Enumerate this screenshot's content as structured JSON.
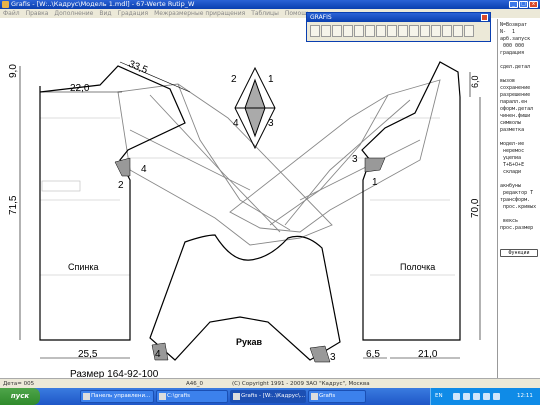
{
  "window": {
    "title": "Grafis - [W:..\\Кадрус\\Модель 1.mdl] - 67-Werte Rutip_W",
    "buttons": [
      "_",
      "□",
      "x"
    ]
  },
  "menu": [
    "Файл",
    "Правка",
    "Дополнение",
    "Вид",
    "Градация",
    "Межразмерные приращения",
    "Таблицы",
    "Помощь"
  ],
  "grafis_toolbar": {
    "title": "GRAFIS",
    "tool_count": 15
  },
  "side_panel": {
    "lines": [
      "N=Возврат",
      "N-  1",
      "арб.запуск",
      " 000 000",
      "градация",
      "",
      "сдел.детал",
      "",
      "вызов",
      "сохранение",
      "разрешение",
      "паралл.ен",
      "оформ.детал",
      "чинен.фиши",
      "символы",
      "разметка",
      "",
      "модел-ие",
      " неремос",
      " уцепиа",
      " Т+Б+О+Е",
      " склади",
      "",
      "акнбуны",
      " редактор Т",
      "трансформ.",
      " прос.кривых",
      "",
      " вексь",
      "прос.размер"
    ],
    "button": "Функции"
  },
  "pattern": {
    "back_dims": {
      "top_width": "22,0",
      "shoulder": "33,5",
      "neck_height": "9,0",
      "length": "71,5",
      "bottom_width": "25,5"
    },
    "front_dims": {
      "neck_height": "6,0",
      "length": "70,0",
      "bottom_left": "6,5",
      "bottom_right": "21,0"
    },
    "labels": {
      "back": "Спинка",
      "front": "Полочка",
      "sleeve": "Рукав",
      "size": "Размер 164-92-100"
    },
    "notches": {
      "back_4": "4",
      "back_2": "2",
      "front_3": "3",
      "front_1": "1",
      "sleeve_4": "4",
      "sleeve_3": "3"
    },
    "diamond": {
      "top_left": "2",
      "top_right": "1",
      "bottom_left": "4",
      "bottom_right": "3"
    }
  },
  "status": {
    "detail": "Дета= 005",
    "code": "A46_0",
    "copyright": "(C) Copyright 1991 - 2009 ЗАО \"Кадрус\", Москва"
  },
  "taskbar": {
    "start": "пуск",
    "tasks": [
      {
        "label": "Панель управлени...",
        "active": false
      },
      {
        "label": "C:\\grafis",
        "active": false
      },
      {
        "label": "Grafis - [W:..\\Кадрус\\...",
        "active": true
      },
      {
        "label": "Grafis",
        "active": false
      }
    ],
    "lang": "EN",
    "clock": "12:11"
  },
  "colors": {
    "accent": "#0a3fb0",
    "pattern_line": "#000000",
    "sleeve_line": "#999999"
  }
}
